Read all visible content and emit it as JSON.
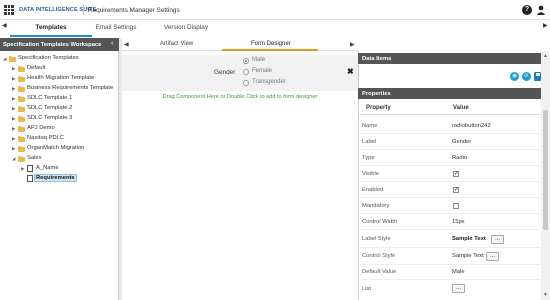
{
  "app": {
    "name": "DATA INTELLIGENCE SUITE",
    "title": "Requirements Manager Settings"
  },
  "top_tabs": [
    {
      "label": "Templates",
      "active": true
    },
    {
      "label": "Email Settings",
      "active": false
    },
    {
      "label": "Version Display",
      "active": false
    }
  ],
  "workspace": {
    "title": "Specification Templates Workspace",
    "root": "Specification Templates",
    "items": [
      "Default",
      "Health Migration Template",
      "Business Requirements Template",
      "SDLC Template 1",
      "SDLC Template 2",
      "SDLC Template 3",
      "APJ Demo",
      "Nasdaq PDLC",
      "OrganMatch Migration",
      "Sales"
    ],
    "sales_children": [
      "A_Name",
      "Requirements"
    ]
  },
  "sub_tabs": [
    {
      "label": "Artifact View",
      "active": false
    },
    {
      "label": "Form Designer",
      "active": true
    }
  ],
  "form": {
    "field_label": "Gender",
    "options": [
      "Male",
      "Female",
      "Transgender"
    ],
    "selected": "Male",
    "drag_hint": "Drag Component Here or Double Click to add to form designer"
  },
  "data_items": {
    "title": "Data Items"
  },
  "properties": {
    "title": "Properties",
    "col_property": "Property",
    "col_value": "Value",
    "name": {
      "label": "Name",
      "value": "radiobutton242"
    },
    "label": {
      "label": "Label",
      "value": "Gender"
    },
    "type": {
      "label": "Type",
      "value": "Radio"
    },
    "visible": {
      "label": "Visible",
      "checked": true
    },
    "enabled": {
      "label": "Enabled",
      "checked": true
    },
    "mandatory": {
      "label": "Mandatory",
      "checked": false
    },
    "control_width": {
      "label": "Control Width",
      "value": "15px"
    },
    "label_style": {
      "label": "Label Style",
      "value": "Sample Text"
    },
    "control_style": {
      "label": "Control Style",
      "value": "Sample Text"
    },
    "default_value": {
      "label": "Default Value",
      "value": "Male"
    },
    "list": {
      "label": "List"
    },
    "ellipsis": "..."
  },
  "colors": {
    "accent": "#1f8fd6",
    "designer_tab": "#e59b1a",
    "hint_text": "#3a9a3a",
    "panel_header": "#555555"
  }
}
